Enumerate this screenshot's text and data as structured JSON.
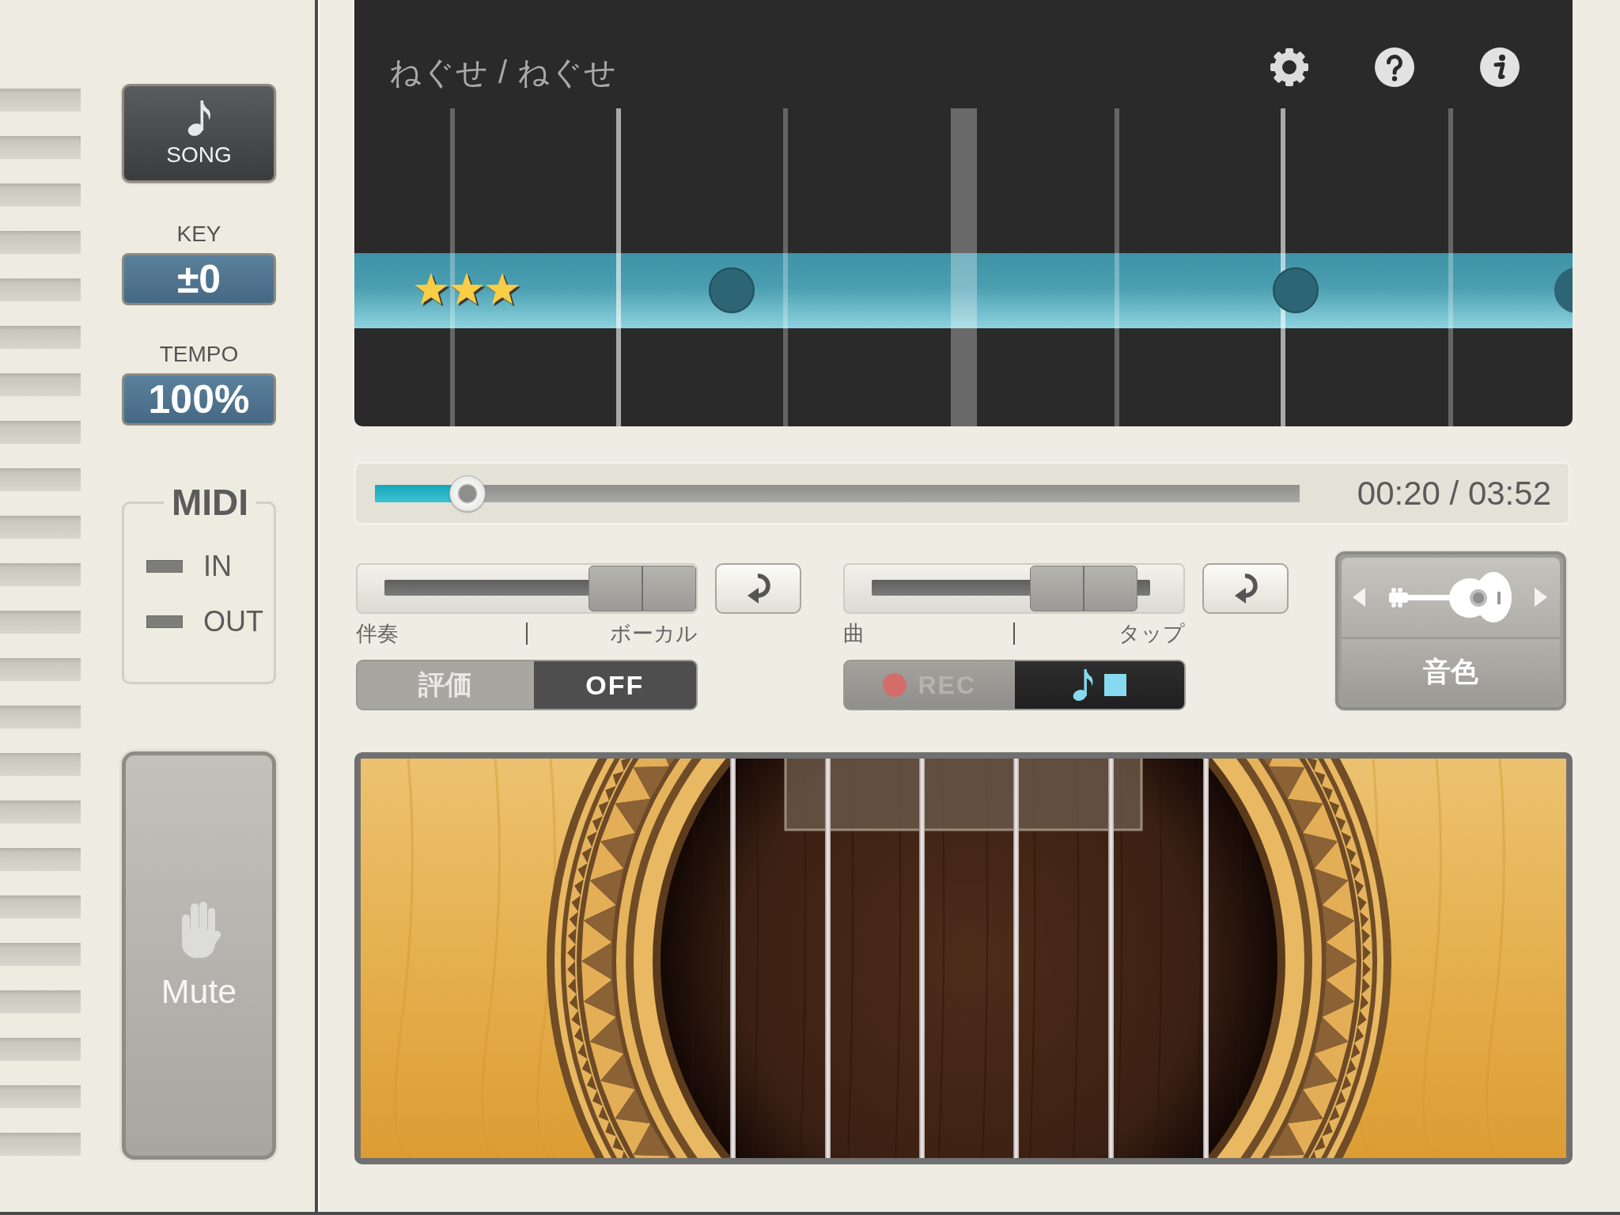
{
  "sidebar": {
    "song_button": {
      "label": "SONG"
    },
    "key": {
      "label": "KEY",
      "value": "±0"
    },
    "tempo": {
      "label": "TEMPO",
      "value": "100%"
    },
    "midi": {
      "title": "MIDI",
      "ports": [
        {
          "label": "IN",
          "on": false
        },
        {
          "label": "OUT",
          "on": false
        }
      ]
    },
    "mute_button": {
      "label": "Mute"
    }
  },
  "track": {
    "title": "ねぐせ / ねぐせ",
    "stars": 3
  },
  "progress": {
    "level": 0.1,
    "time": "00:20 / 03:52"
  },
  "mixers": [
    {
      "left_label": "伴奏",
      "right_label": "ボーカル",
      "level": 1
    },
    {
      "left_label": "曲",
      "right_label": "タップ",
      "level": 0.8
    }
  ],
  "evaluation_switch": {
    "label": "評価",
    "value": "OFF",
    "on": false
  },
  "mode_switch": [
    {
      "kind": "rec",
      "label": "REC",
      "selected": false
    },
    {
      "kind": "play",
      "selected": true
    }
  ],
  "tone": {
    "label": "音色"
  }
}
